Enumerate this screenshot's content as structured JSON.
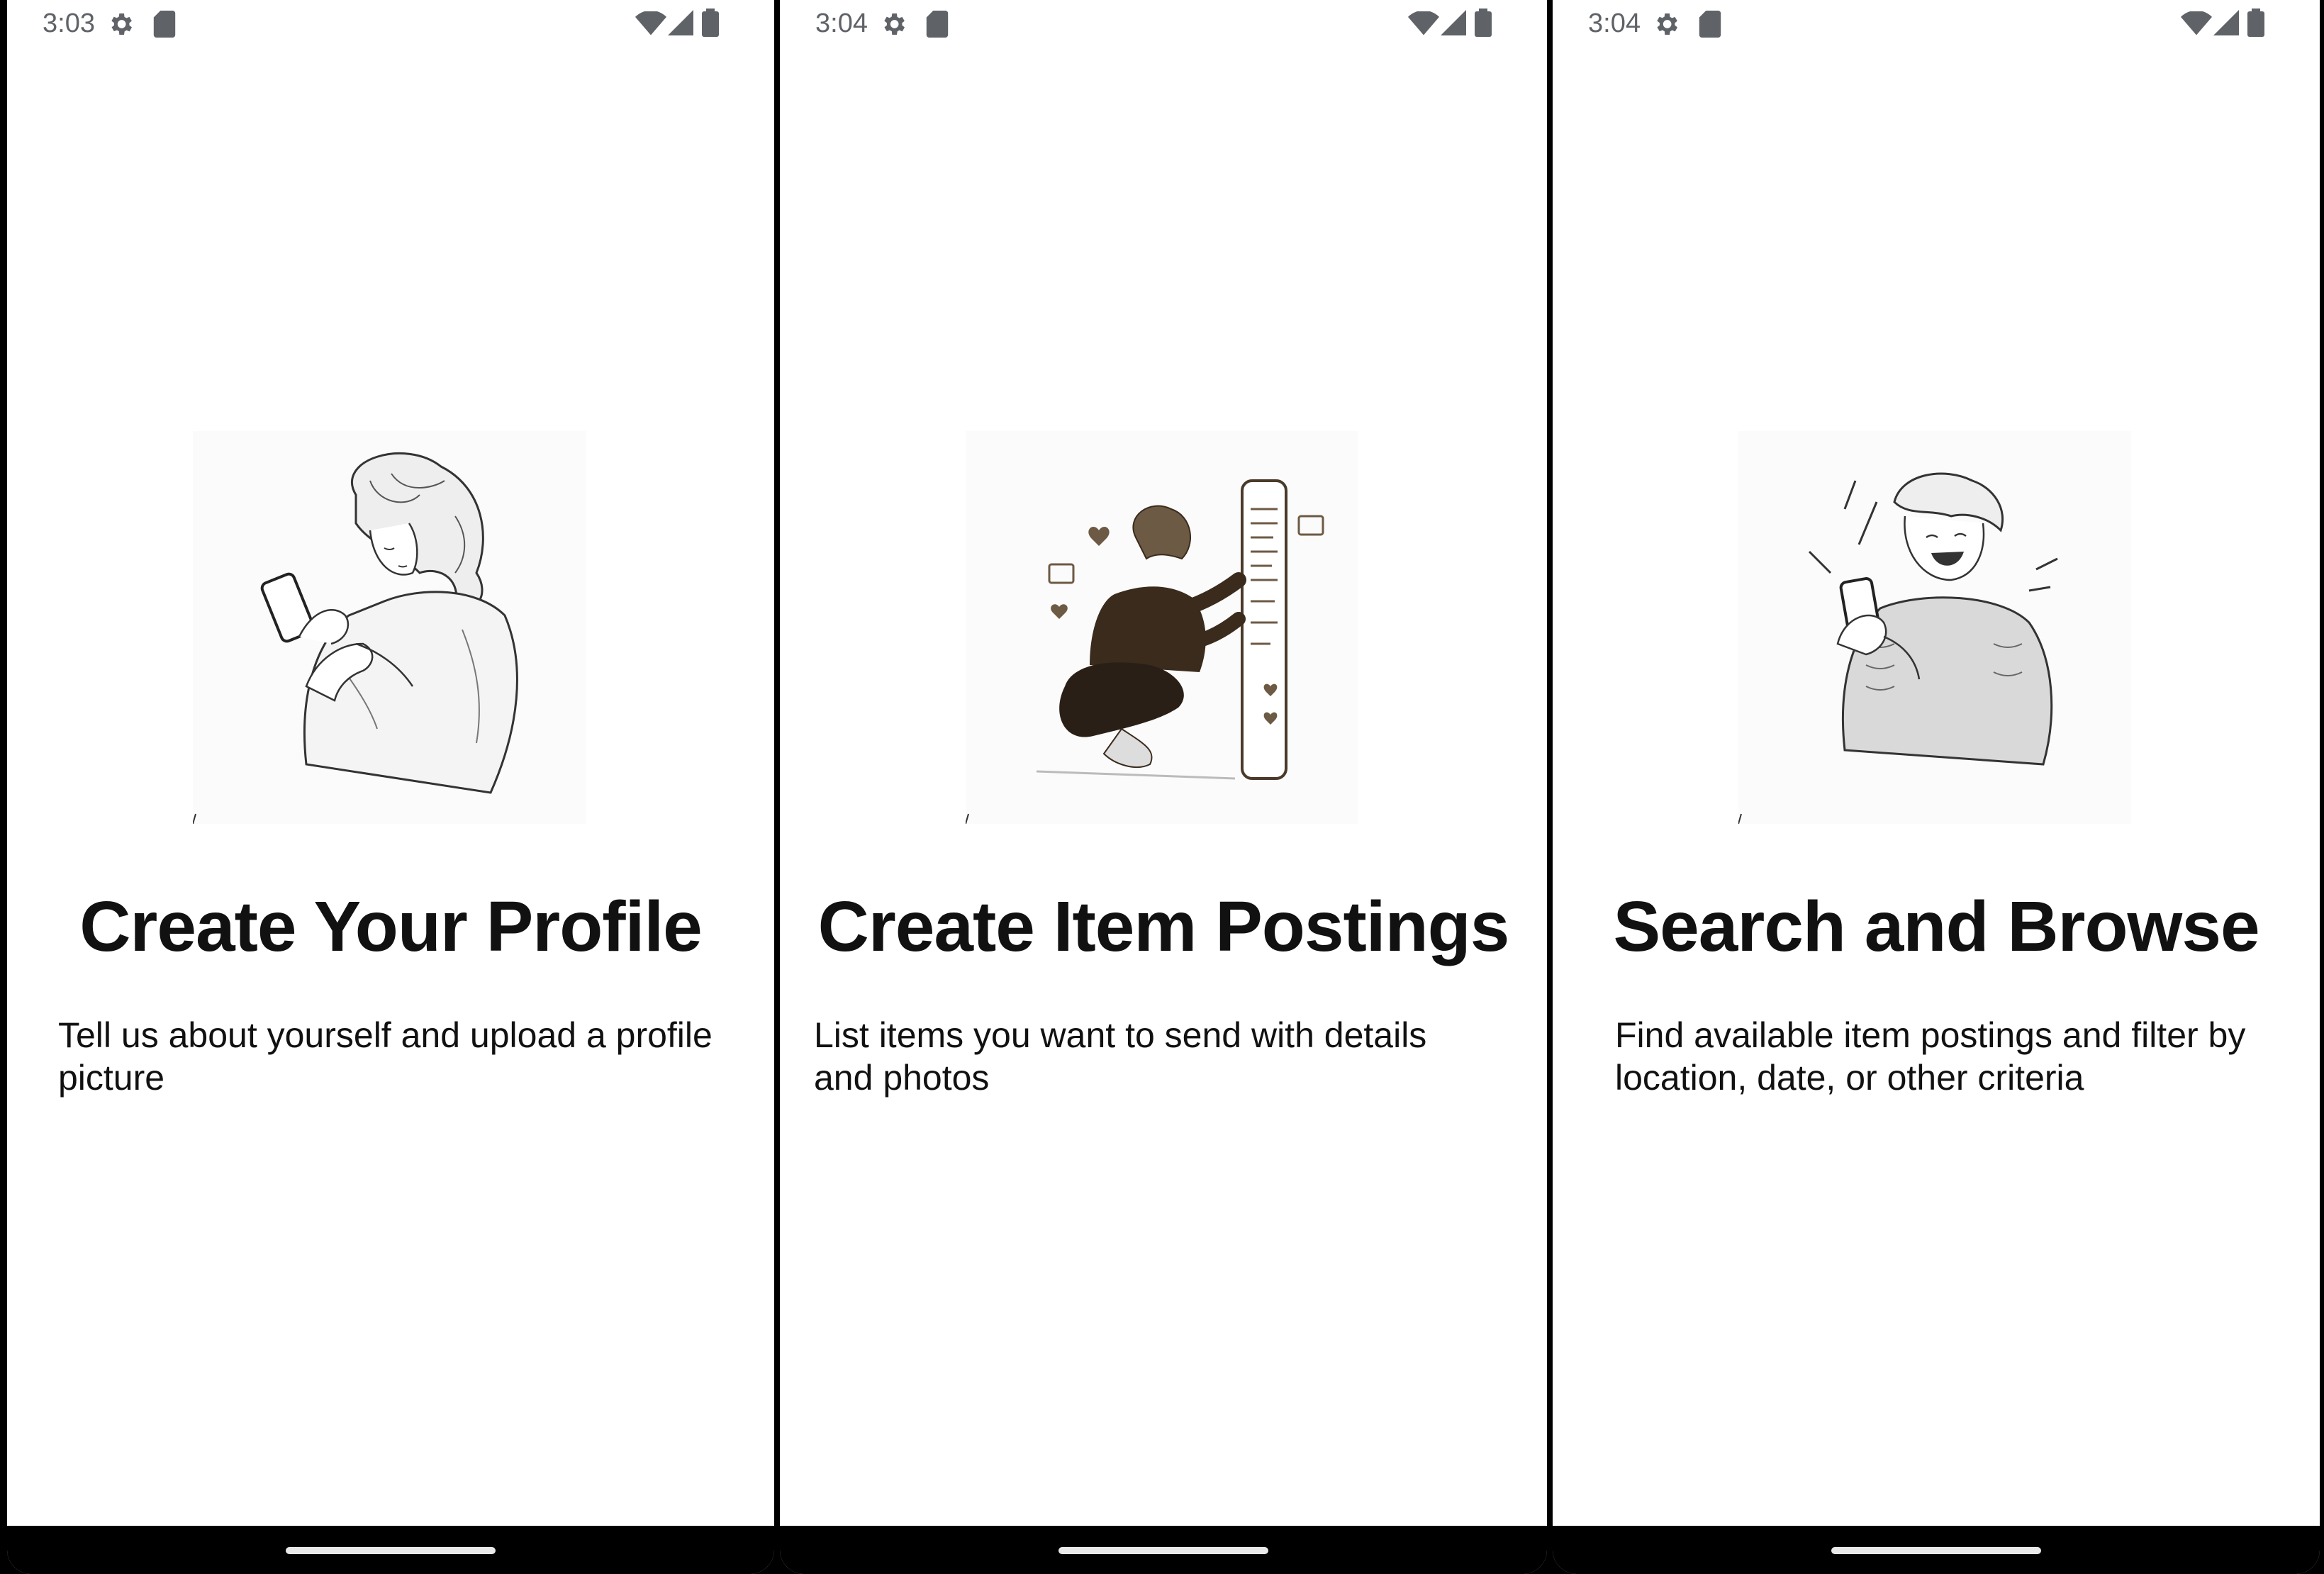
{
  "screens": [
    {
      "time": "3:03",
      "title": "Create Your Profile",
      "description": "Tell us about yourself and upload a profile picture",
      "illustration": "woman-with-phone-sketch"
    },
    {
      "time": "3:04",
      "title": "Create Item Postings",
      "description": "List items you want to send with details and photos",
      "illustration": "woman-posting-on-giant-phone-sketch"
    },
    {
      "time": "3:04",
      "title": "Search and Browse",
      "description": "Find available item postings and filter by location, date, or other criteria",
      "illustration": "laughing-man-with-phone-sketch"
    }
  ],
  "icons": {
    "status_left": [
      "settings-gear-icon",
      "sd-card-icon"
    ],
    "status_right": [
      "wifi-icon",
      "cell-signal-icon",
      "battery-icon"
    ]
  },
  "colors": {
    "background": "#ffffff",
    "text": "#111111",
    "status_text": "#5f6368",
    "nav_bar": "#000000",
    "nav_pill": "#e9e9e9"
  }
}
